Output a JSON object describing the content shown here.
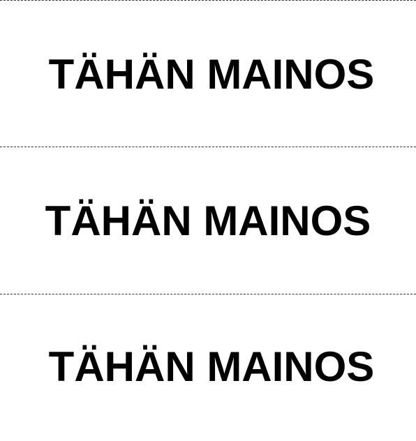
{
  "panels": [
    {
      "text": "TÄHÄN MAINOS"
    },
    {
      "text": "TÄHÄN MAINOS"
    },
    {
      "text": "TÄHÄN MAINOS"
    }
  ],
  "colors": {
    "text": "#000000",
    "divider": "#333333",
    "background": "#ffffff"
  }
}
